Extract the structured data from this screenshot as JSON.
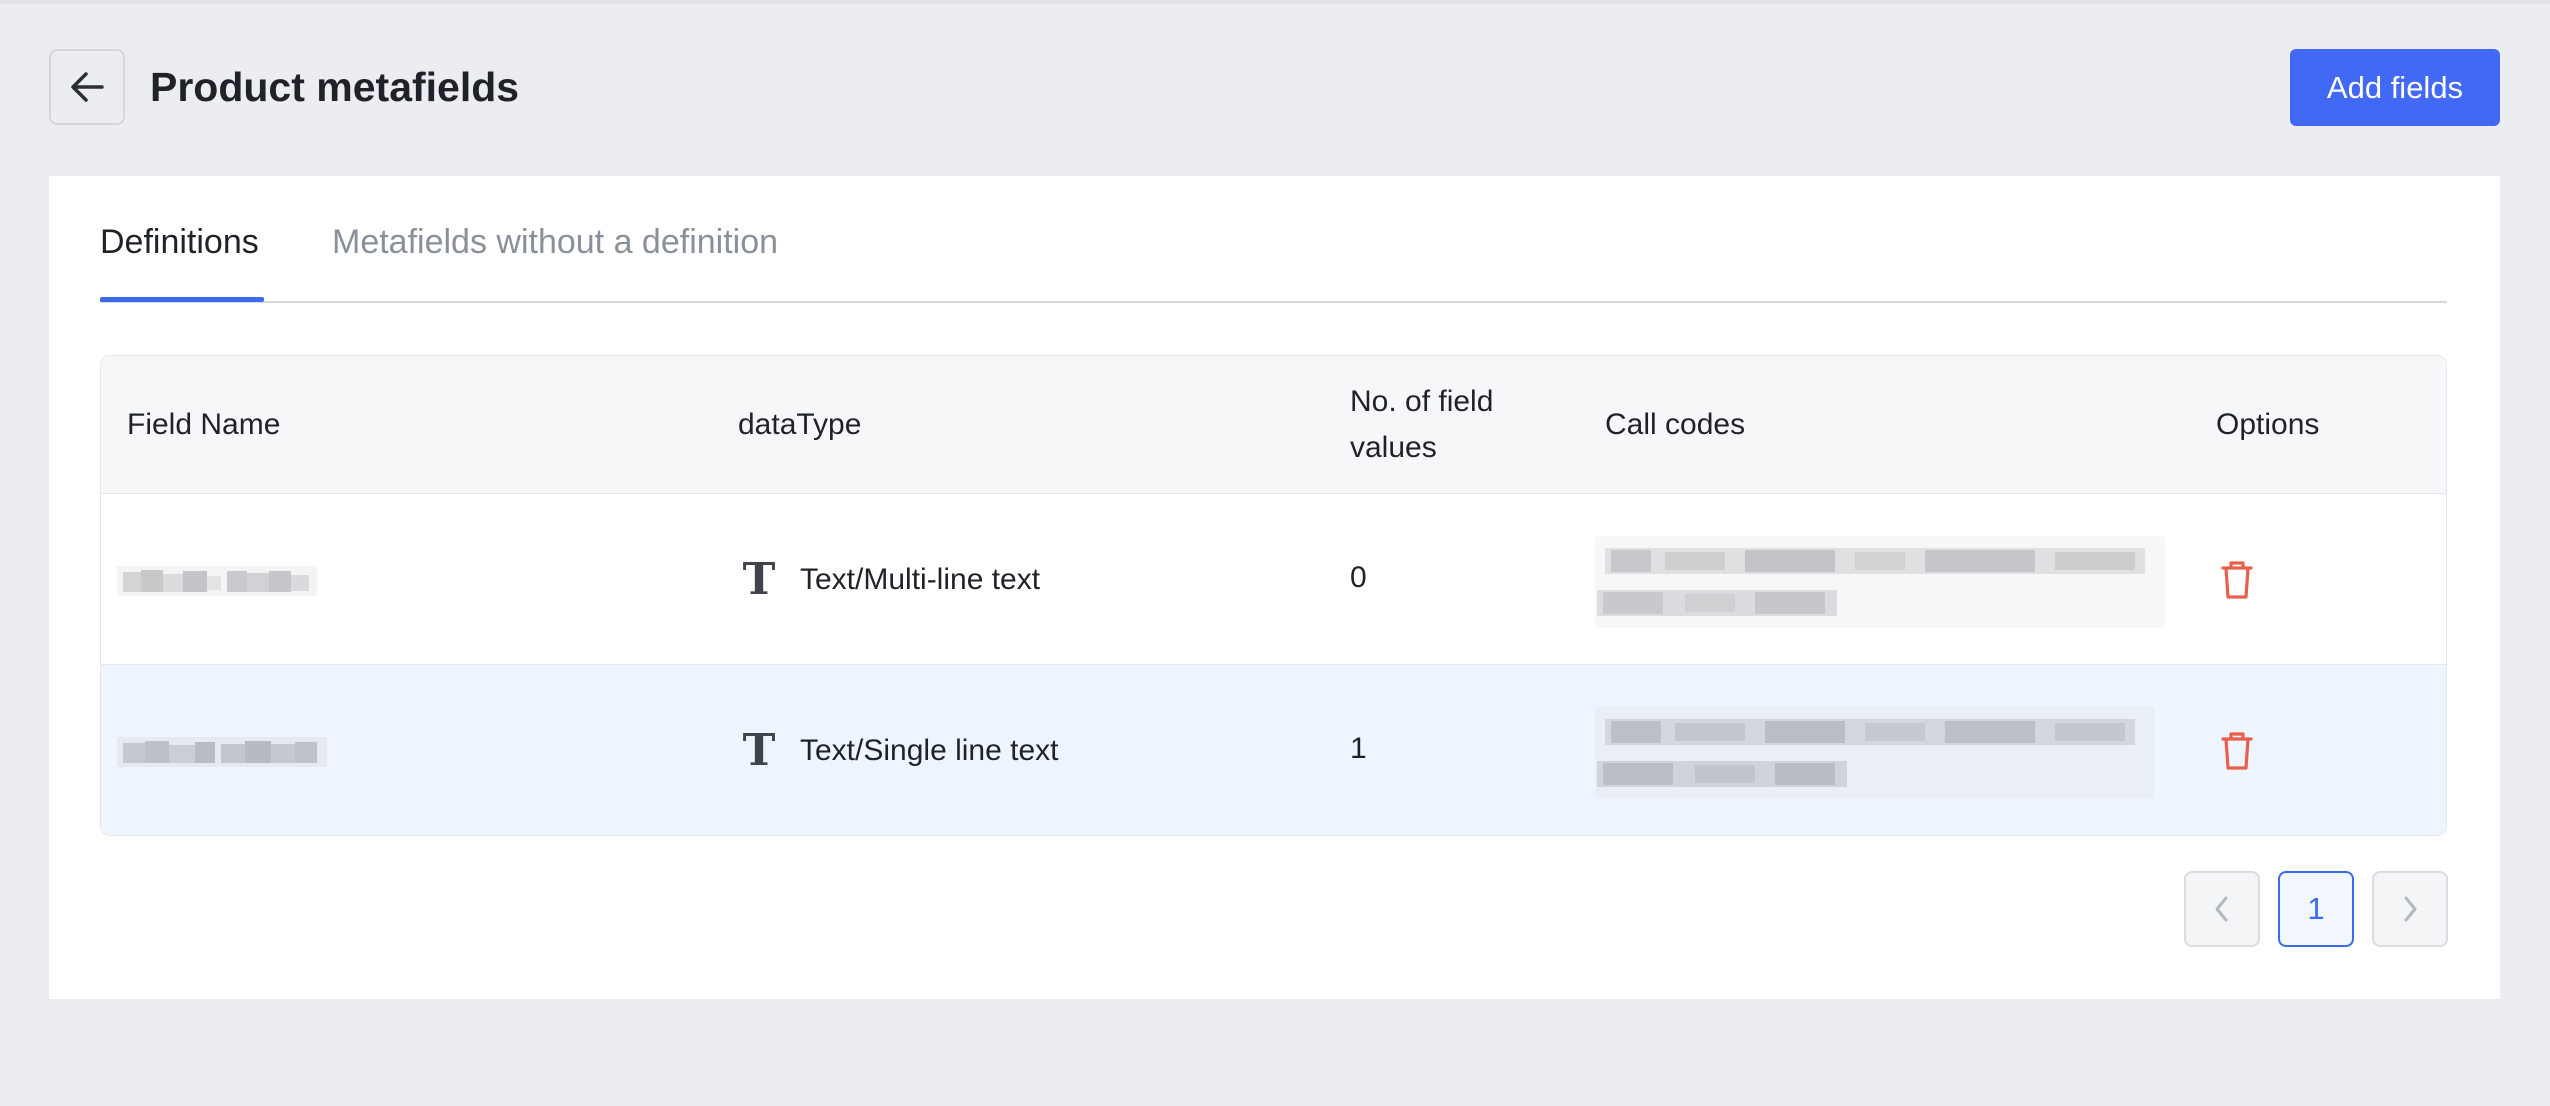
{
  "header": {
    "title": "Product metafields",
    "add_button": "Add fields",
    "back_icon": "arrow-left-icon"
  },
  "tabs": [
    {
      "label": "Definitions",
      "active": true
    },
    {
      "label": "Metafields without a definition",
      "active": false
    }
  ],
  "table": {
    "columns": [
      "Field Name",
      "dataType",
      "No. of field\nvalues",
      "Call codes",
      "Options"
    ],
    "rows": [
      {
        "field_name": "",
        "data_type": "Text/Multi-line text",
        "count": "0",
        "call_code": "",
        "type_icon": "text-type-icon"
      },
      {
        "field_name": "",
        "data_type": "Text/Single line text",
        "count": "1",
        "call_code": "",
        "type_icon": "text-type-icon"
      }
    ]
  },
  "pagination": {
    "current": "1"
  },
  "colors": {
    "accent": "#4169f5",
    "delete": "#e8604c",
    "background": "#ebedf0"
  }
}
